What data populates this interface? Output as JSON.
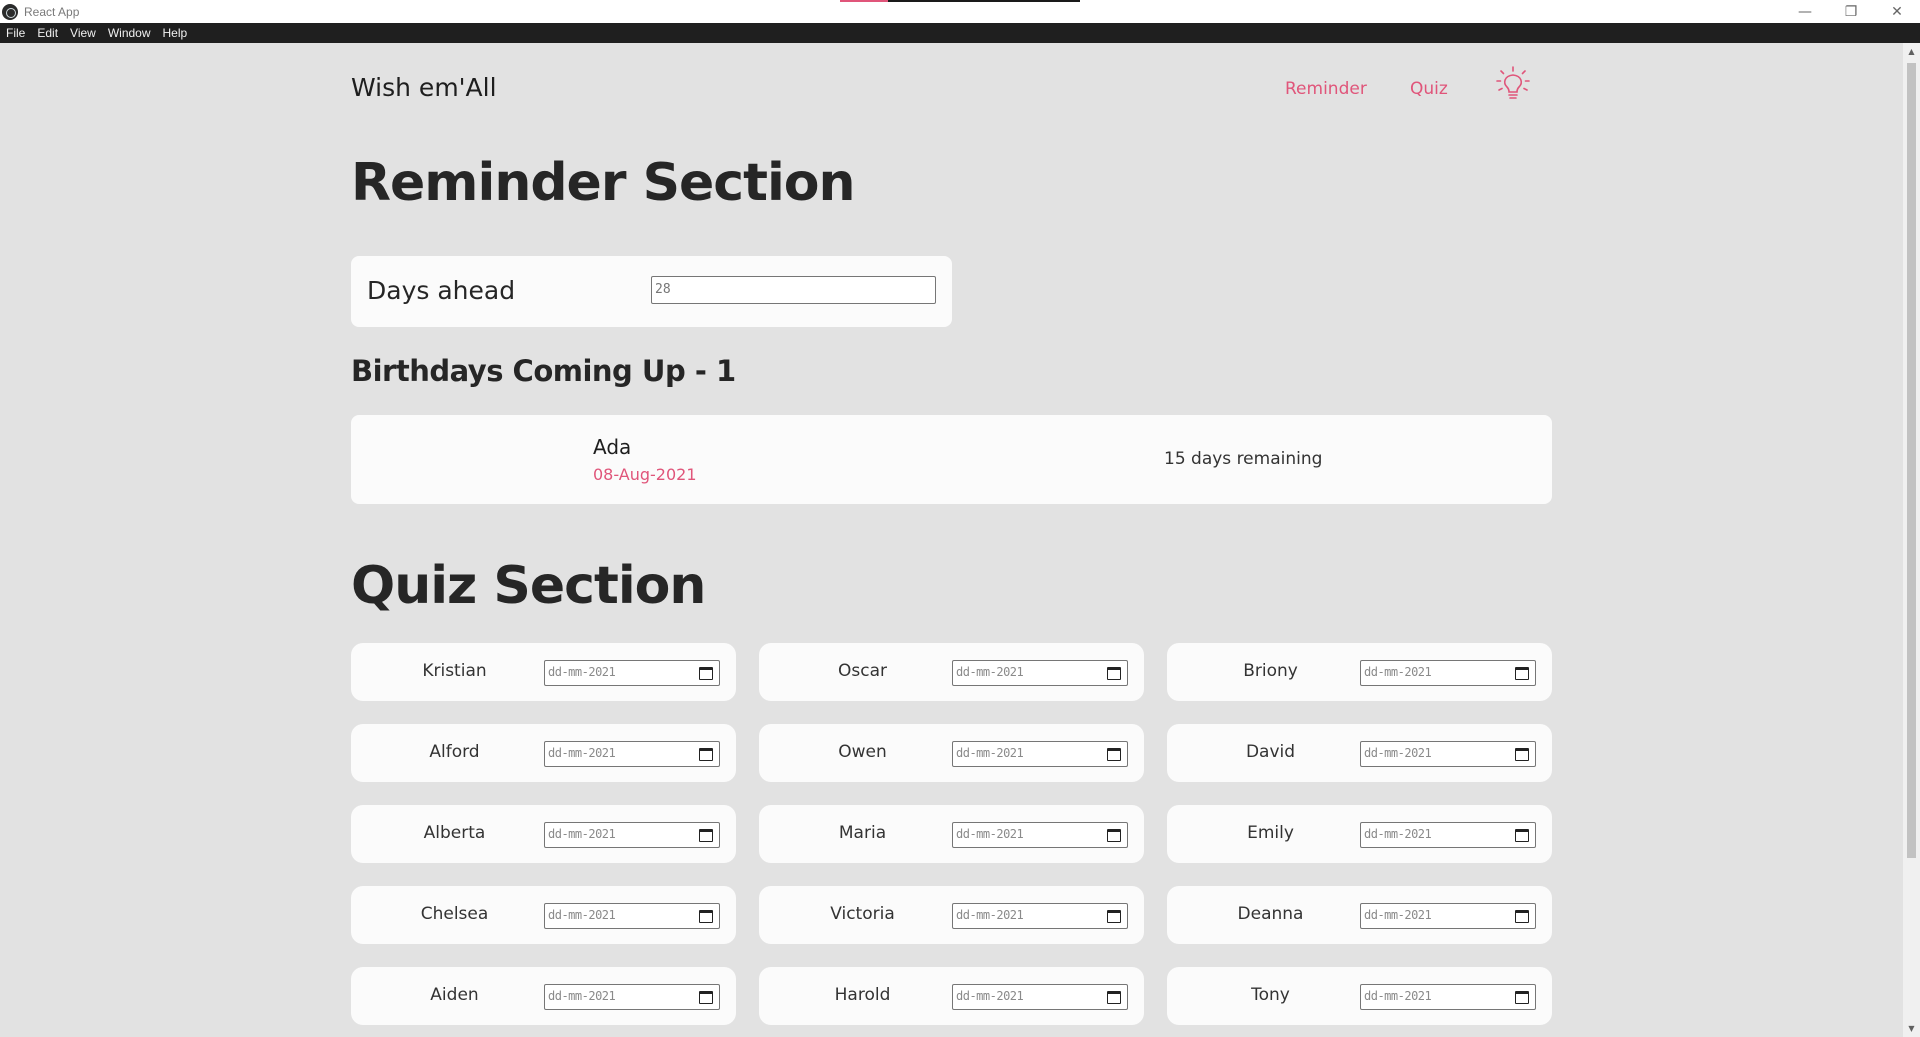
{
  "window": {
    "title": "React App",
    "controls": {
      "minimize": "—",
      "restore": "❐",
      "close": "✕"
    }
  },
  "menu": [
    "File",
    "Edit",
    "View",
    "Window",
    "Help"
  ],
  "nav": {
    "brand": "Wish em'All",
    "links": [
      "Reminder",
      "Quiz"
    ],
    "theme_toggle_icon": "lightbulb-icon"
  },
  "reminder": {
    "title": "Reminder Section",
    "days_ahead_label": "Days ahead",
    "days_ahead_value": "28",
    "birthdays_heading": "Birthdays Coming Up - 1",
    "birthdays": [
      {
        "name": "Ada",
        "date": "08-Aug-2021",
        "remaining": "15 days remaining"
      }
    ]
  },
  "quiz": {
    "title": "Quiz Section",
    "date_placeholder": "dd-mm-2021",
    "people": [
      "Kristian",
      "Oscar",
      "Briony",
      "Alford",
      "Owen",
      "David",
      "Alberta",
      "Maria",
      "Emily",
      "Chelsea",
      "Victoria",
      "Deanna",
      "Aiden",
      "Harold",
      "Tony"
    ]
  },
  "colors": {
    "accent": "#e0557a",
    "background": "#e2e2e2",
    "card": "#fbfbfb",
    "menubar": "#1f1f1f"
  }
}
